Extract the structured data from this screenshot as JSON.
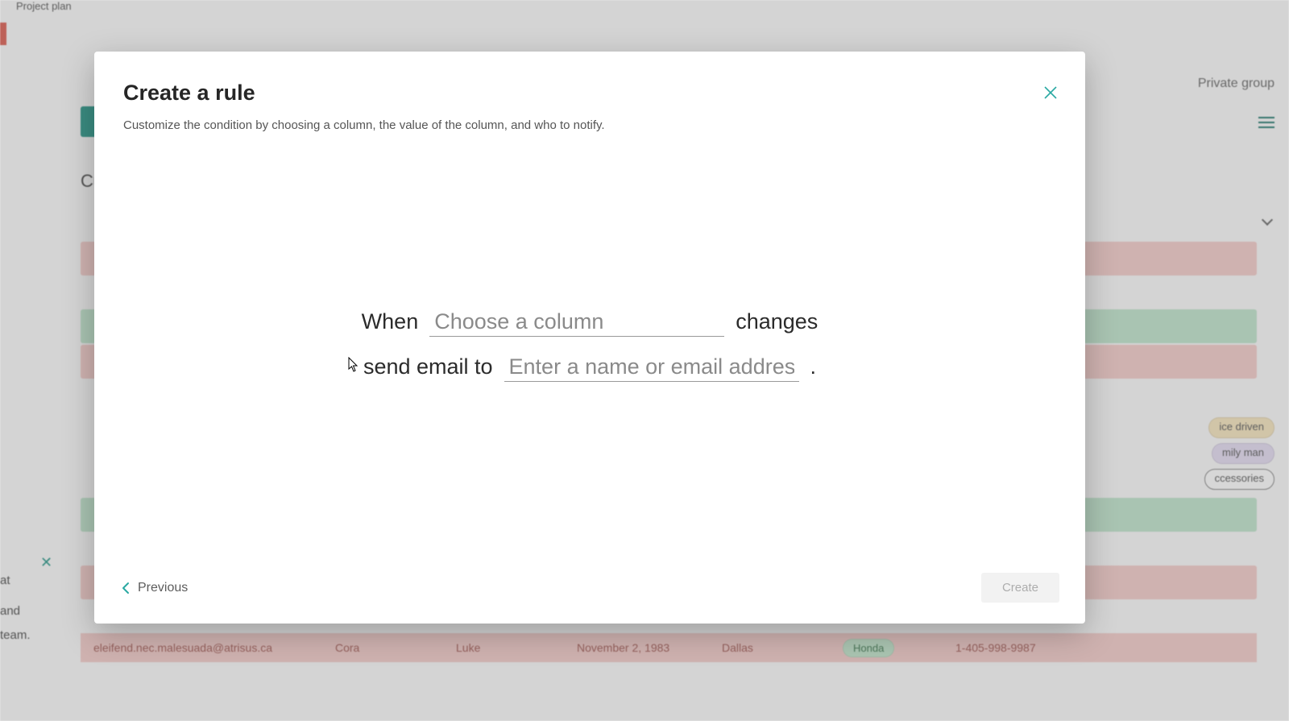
{
  "background": {
    "breadcrumb": "Project plan",
    "private_label": "Private group",
    "cu_text": "Cu",
    "chat_at": "at",
    "chat_line1": "and",
    "chat_line2": "team.",
    "pills": {
      "orange": "ice driven",
      "purple": "mily man",
      "outline": "ccessories"
    },
    "row": {
      "email": "eleifend.nec.malesuada@atrisus.ca",
      "c1": "Cora",
      "c2": "Luke",
      "c3": "November 2, 1983",
      "c4": "Dallas",
      "tag": "Honda",
      "phone": "1-405-998-9987"
    }
  },
  "modal": {
    "title": "Create a rule",
    "subtitle": "Customize the condition by choosing a column, the value of the column, and who to notify.",
    "line1": {
      "when": "When",
      "column_placeholder": "Choose a column",
      "changes": "changes"
    },
    "line2": {
      "send": "send email to",
      "recipient_placeholder": "Enter a name or email address",
      "period": "."
    },
    "previous": "Previous",
    "create": "Create"
  }
}
